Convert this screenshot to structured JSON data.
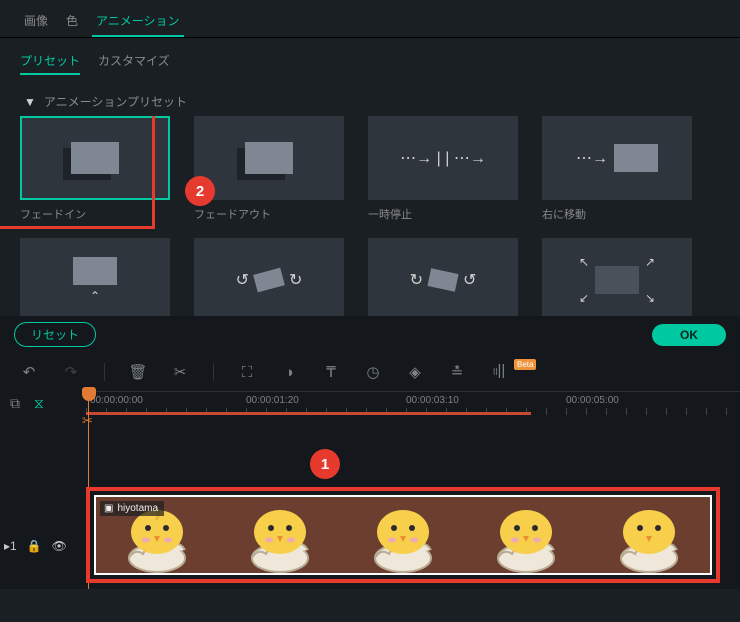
{
  "top_tabs": {
    "image": "画像",
    "color": "色",
    "animation": "アニメーション"
  },
  "sub_tabs": {
    "preset": "プリセット",
    "customize": "カスタマイズ"
  },
  "section": {
    "title": "アニメーションプリセット"
  },
  "presets": [
    {
      "name": "フェードイン"
    },
    {
      "name": "フェードアウト"
    },
    {
      "name": "一時停止"
    },
    {
      "name": "右に移動"
    }
  ],
  "buttons": {
    "reset": "リセット",
    "ok": "OK"
  },
  "timeline": {
    "ticks": [
      "00:00:00:00",
      "00:00:01:20",
      "00:00:03:10",
      "00:00:05:00"
    ],
    "range_end_pct": 68
  },
  "clip": {
    "name": "hiyotama"
  },
  "annotations": {
    "one": "1",
    "two": "2"
  },
  "toolbar_beta": "Beta"
}
